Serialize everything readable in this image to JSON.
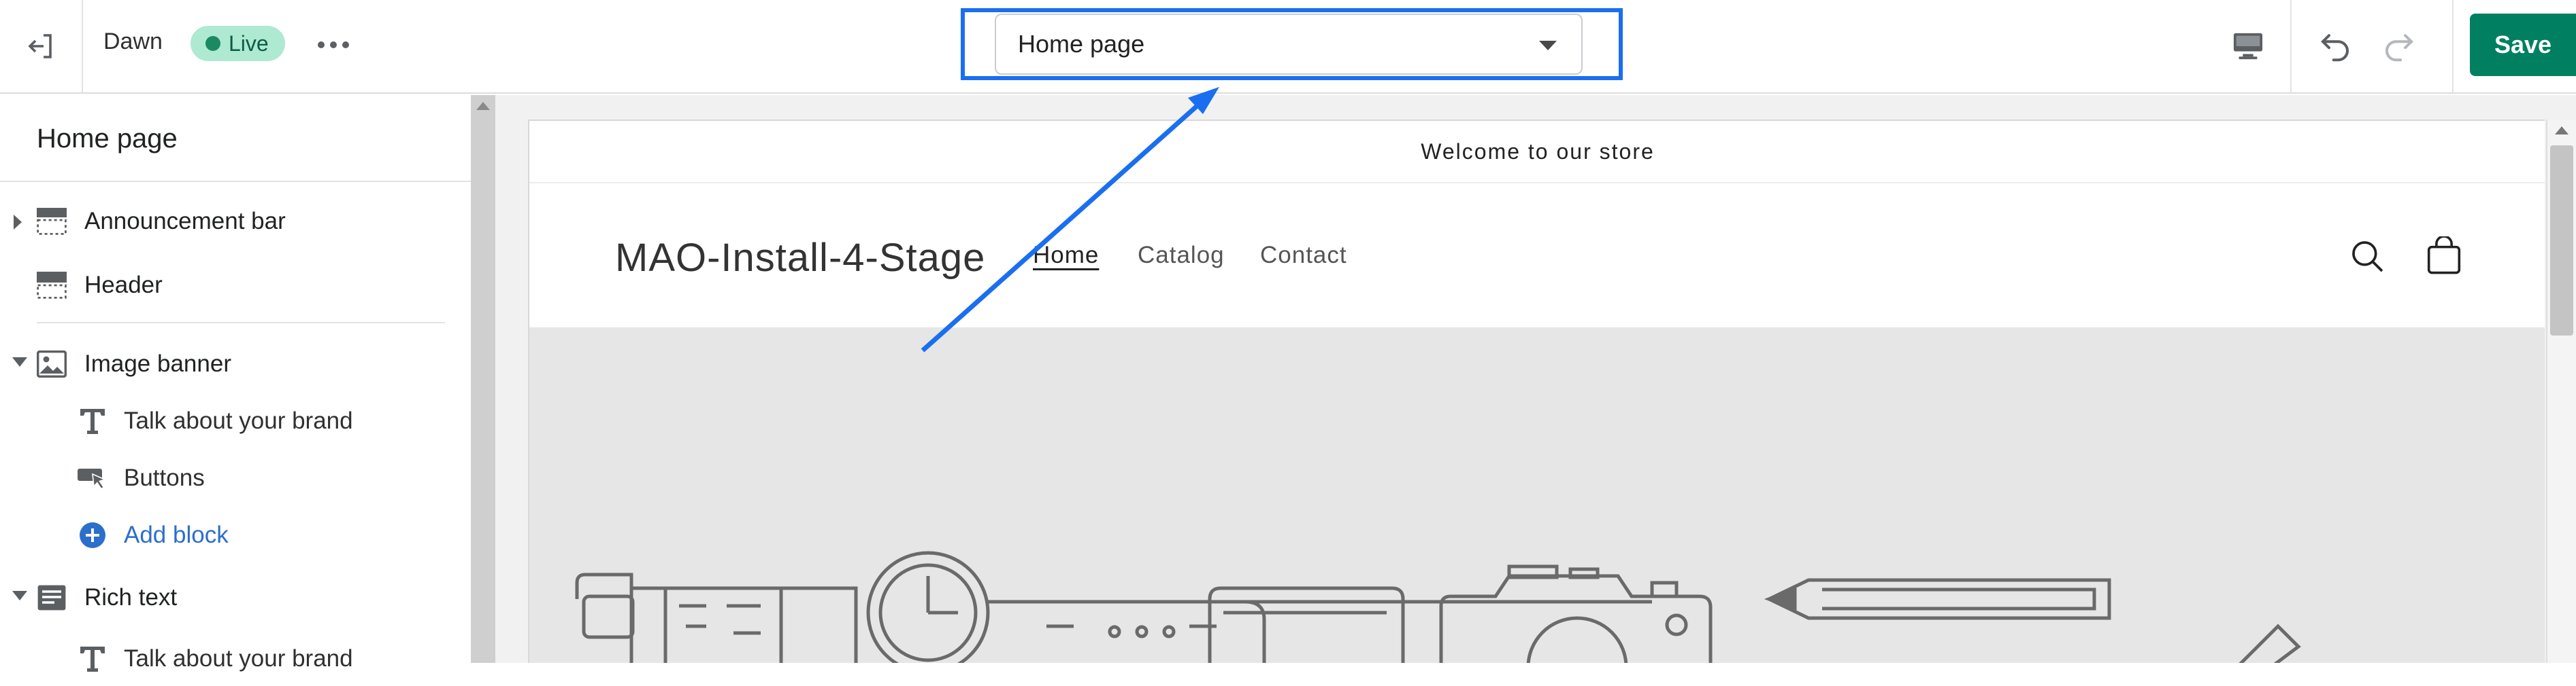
{
  "topbar": {
    "theme_name": "Dawn",
    "live_badge": "Live",
    "page_selector_value": "Home page",
    "save_label": "Save"
  },
  "sidebar": {
    "title": "Home page",
    "items": [
      {
        "label": "Announcement bar"
      },
      {
        "label": "Header"
      },
      {
        "label": "Image banner"
      },
      {
        "label": "Talk about your brand"
      },
      {
        "label": "Buttons"
      },
      {
        "label": "Add block"
      },
      {
        "label": "Rich text"
      },
      {
        "label": "Talk about your brand"
      }
    ]
  },
  "preview": {
    "announcement": "Welcome to our store",
    "store_name": "MAO-Install-4-Stage",
    "nav": [
      "Home",
      "Catalog",
      "Contact"
    ]
  },
  "colors": {
    "accent_blue": "#1a6ff0",
    "save_green": "#008060",
    "live_bg": "#aee9d1",
    "link_blue": "#2c6ecb"
  },
  "icons": [
    "exit-icon",
    "more-icon",
    "chevron-down-icon",
    "desktop-icon",
    "undo-icon",
    "redo-icon",
    "section-icon",
    "image-icon",
    "text-icon",
    "button-icon",
    "add-circle-icon",
    "search-icon",
    "cart-icon"
  ]
}
